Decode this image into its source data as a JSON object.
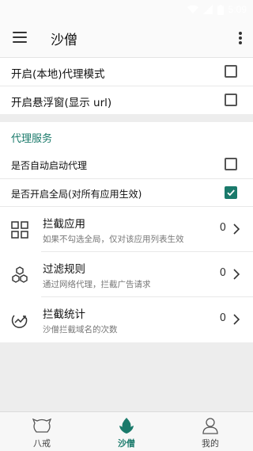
{
  "status_bar": {
    "time": "5:09"
  },
  "toolbar": {
    "title": "沙僧"
  },
  "settings_top": {
    "items": [
      {
        "label": "开启(本地)代理模式",
        "checked": false
      },
      {
        "label": "开启悬浮窗(显示 url)",
        "checked": false
      }
    ]
  },
  "proxy_section": {
    "header": "代理服务",
    "toggles": [
      {
        "label": "是否自动启动代理",
        "checked": false
      },
      {
        "label": "是否开启全局(对所有应用生效)",
        "checked": true
      }
    ],
    "nav_items": [
      {
        "title": "拦截应用",
        "subtitle": "如果不勾选全局，仅对该应用列表生效",
        "count": "0",
        "icon": "grid-icon"
      },
      {
        "title": "过滤规则",
        "subtitle": "通过网络代理，拦截广告请求",
        "count": "0",
        "icon": "hexagons-icon"
      },
      {
        "title": "拦截统计",
        "subtitle": "沙僧拦截域名的次数",
        "count": "0",
        "icon": "trend-icon"
      }
    ]
  },
  "bottom_nav": {
    "tabs": [
      {
        "label": "八戒",
        "icon": "pig-icon",
        "active": false
      },
      {
        "label": "沙僧",
        "icon": "leaf-icon",
        "active": true
      },
      {
        "label": "我的",
        "icon": "person-icon",
        "active": false
      }
    ]
  },
  "colors": {
    "accent": "#1a7a6b",
    "background": "#ededed",
    "card": "#ffffff"
  }
}
